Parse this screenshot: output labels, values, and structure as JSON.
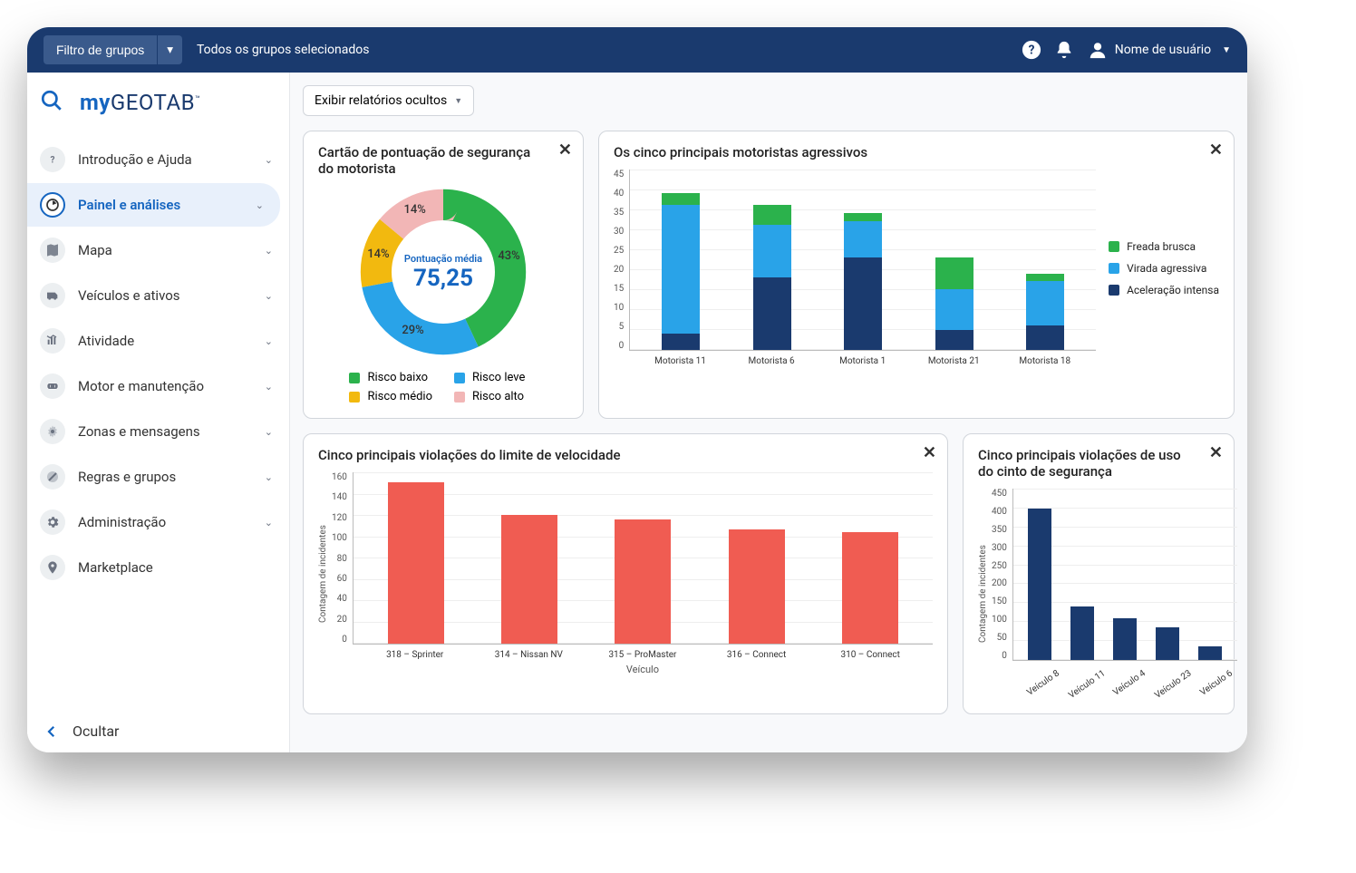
{
  "topbar": {
    "group_filter_label": "Filtro de grupos",
    "all_groups_text": "Todos os grupos selecionados",
    "username": "Nome de usuário"
  },
  "sidebar": {
    "items": [
      {
        "label": "Introdução e Ajuda",
        "expandable": true
      },
      {
        "label": "Painel e análises",
        "expandable": true,
        "active": true
      },
      {
        "label": "Mapa",
        "expandable": true
      },
      {
        "label": "Veículos e ativos",
        "expandable": true
      },
      {
        "label": "Atividade",
        "expandable": true
      },
      {
        "label": "Motor e manutenção",
        "expandable": true
      },
      {
        "label": "Zonas e mensagens",
        "expandable": true
      },
      {
        "label": "Regras e grupos",
        "expandable": true
      },
      {
        "label": "Administração",
        "expandable": true
      },
      {
        "label": "Marketplace",
        "expandable": false
      }
    ],
    "hide_label": "Ocultar"
  },
  "content": {
    "hidden_reports_label": "Exibir relatórios ocultos"
  },
  "card_safety": {
    "title": "Cartão de pontuação de segurança do motorista",
    "avg_label": "Pontuação média",
    "avg_value": "75,25",
    "legend": [
      {
        "label": "Risco baixo",
        "color": "#2bb24c"
      },
      {
        "label": "Risco leve",
        "color": "#29a3e8"
      },
      {
        "label": "Risco médio",
        "color": "#f2b90f"
      },
      {
        "label": "Risco alto",
        "color": "#f2b6b6"
      }
    ],
    "slices": [
      {
        "label": "43%",
        "value": 43,
        "color": "#2bb24c"
      },
      {
        "label": "29%",
        "value": 29,
        "color": "#29a3e8"
      },
      {
        "label": "14%",
        "value": 14,
        "color": "#f2b90f"
      },
      {
        "label": "14%",
        "value": 14,
        "color": "#f2b6b6"
      }
    ]
  },
  "card_aggressive": {
    "title": "Os cinco principais motoristas agressivos",
    "y_ticks": [
      "45",
      "40",
      "35",
      "30",
      "25",
      "20",
      "15",
      "10",
      "5",
      "0"
    ],
    "legend": [
      {
        "label": "Freada brusca",
        "color": "#2bb24c"
      },
      {
        "label": "Virada agressiva",
        "color": "#29a3e8"
      },
      {
        "label": "Aceleração intensa",
        "color": "#1a3a6e"
      }
    ]
  },
  "card_speed": {
    "title": "Cinco principais violações do limite de velocidade",
    "y_label": "Contagem de incidentes",
    "x_label": "Veículo",
    "y_ticks": [
      "160",
      "140",
      "120",
      "100",
      "80",
      "60",
      "40",
      "20",
      "0"
    ]
  },
  "card_seatbelt": {
    "title": "Cinco principais violações de uso do cinto de segurança",
    "y_label": "Contagem de incidentes",
    "y_ticks": [
      "450",
      "400",
      "350",
      "300",
      "250",
      "200",
      "150",
      "100",
      "50",
      "0"
    ]
  },
  "chart_data": [
    {
      "id": "safety_donut",
      "type": "pie",
      "title": "Cartão de pontuação de segurança do motorista",
      "center_label": "Pontuação média",
      "center_value": 75.25,
      "series": [
        {
          "name": "Risco baixo",
          "value": 43,
          "color": "#2bb24c"
        },
        {
          "name": "Risco leve",
          "value": 29,
          "color": "#29a3e8"
        },
        {
          "name": "Risco médio",
          "value": 14,
          "color": "#f2b90f"
        },
        {
          "name": "Risco alto",
          "value": 14,
          "color": "#f2b6b6"
        }
      ]
    },
    {
      "id": "aggressive_drivers",
      "type": "bar",
      "stacked": true,
      "title": "Os cinco principais motoristas agressivos",
      "categories": [
        "Motorista 11",
        "Motorista 6",
        "Motorista 1",
        "Motorista 21",
        "Motorista 18"
      ],
      "series": [
        {
          "name": "Aceleração intensa",
          "color": "#1a3a6e",
          "values": [
            4,
            18,
            23,
            5,
            6
          ]
        },
        {
          "name": "Virada agressiva",
          "color": "#29a3e8",
          "values": [
            32,
            13,
            9,
            10,
            11
          ]
        },
        {
          "name": "Freada brusca",
          "color": "#2bb24c",
          "values": [
            3,
            5,
            2,
            8,
            2
          ]
        }
      ],
      "ylim": [
        0,
        45
      ],
      "xlabel": "",
      "ylabel": ""
    },
    {
      "id": "speed_violations",
      "type": "bar",
      "title": "Cinco principais violações do limite de velocidade",
      "categories": [
        "318 – Sprinter",
        "314 – Nissan NV",
        "315 – ProMaster",
        "316 – Connect",
        "310 – Connect"
      ],
      "values": [
        150,
        120,
        115,
        106,
        104
      ],
      "color": "#f05c52",
      "ylim": [
        0,
        160
      ],
      "xlabel": "Veículo",
      "ylabel": "Contagem de incidentes"
    },
    {
      "id": "seatbelt_violations",
      "type": "bar",
      "title": "Cinco principais violações de uso do cinto de segurança",
      "categories": [
        "Veículo 8",
        "Veículo 11",
        "Veículo 4",
        "Veículo 23",
        "Veículo 6"
      ],
      "values": [
        395,
        140,
        110,
        85,
        35
      ],
      "color": "#1a3a6e",
      "ylim": [
        0,
        450
      ],
      "xlabel": "",
      "ylabel": "Contagem de incidentes"
    }
  ]
}
